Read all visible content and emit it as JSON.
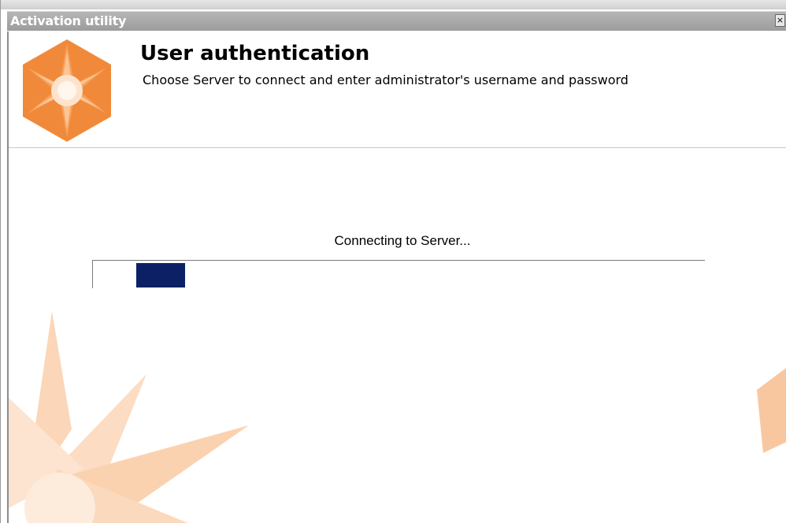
{
  "window": {
    "title": "Activation utility",
    "close_glyph": "×"
  },
  "header": {
    "title": "User authentication",
    "subtitle": "Choose Server to connect and enter administrator's username and password",
    "logo_icon": "orange-star-hexagon-logo"
  },
  "main": {
    "status_text": "Connecting to Server...",
    "progress": {
      "state": "indeterminate-marquee",
      "chunk_color": "#0c2066"
    }
  },
  "colors": {
    "titlebar": "#a8a8a8",
    "accent_orange": "#f08a3a",
    "accent_light": "#fbd6b8"
  }
}
